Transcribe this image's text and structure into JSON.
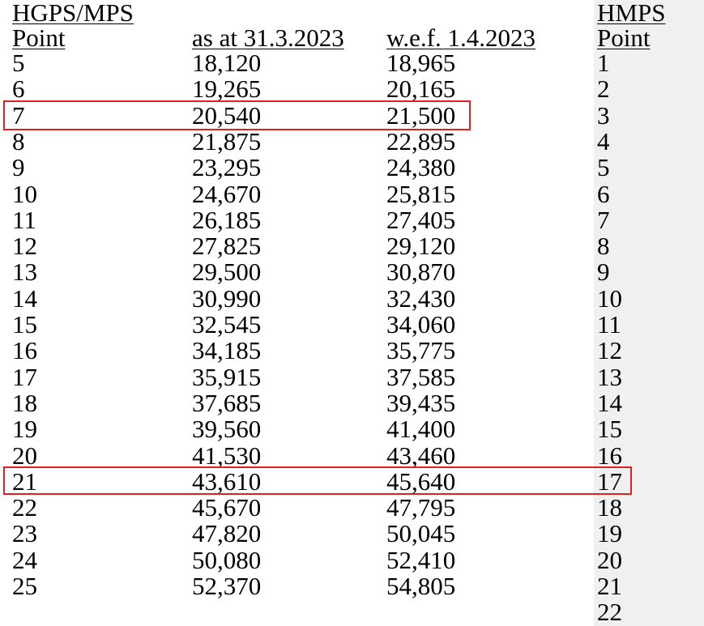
{
  "headers": {
    "hgps_mps": "HGPS/MPS",
    "point": "Point",
    "as_at": "as at 31.3.2023",
    "wef": "w.e.f. 1.4.2023",
    "hmps": "HMPS",
    "hmps_point": "Point"
  },
  "rows": [
    {
      "point": "5",
      "old": "18,120",
      "new": "18,965"
    },
    {
      "point": "6",
      "old": "19,265",
      "new": "20,165"
    },
    {
      "point": "7",
      "old": "20,540",
      "new": "21,500"
    },
    {
      "point": "8",
      "old": "21,875",
      "new": "22,895"
    },
    {
      "point": "9",
      "old": "23,295",
      "new": "24,380"
    },
    {
      "point": "10",
      "old": "24,670",
      "new": "25,815"
    },
    {
      "point": "11",
      "old": "26,185",
      "new": "27,405"
    },
    {
      "point": "12",
      "old": "27,825",
      "new": "29,120"
    },
    {
      "point": "13",
      "old": "29,500",
      "new": "30,870"
    },
    {
      "point": "14",
      "old": "30,990",
      "new": "32,430"
    },
    {
      "point": "15",
      "old": "32,545",
      "new": "34,060"
    },
    {
      "point": "16",
      "old": "34,185",
      "new": "35,775"
    },
    {
      "point": "17",
      "old": "35,915",
      "new": "37,585"
    },
    {
      "point": "18",
      "old": "37,685",
      "new": "39,435"
    },
    {
      "point": "19",
      "old": "39,560",
      "new": "41,400"
    },
    {
      "point": "20",
      "old": "41,530",
      "new": "43,460"
    },
    {
      "point": "21",
      "old": "43,610",
      "new": "45,640"
    },
    {
      "point": "22",
      "old": "45,670",
      "new": "47,795"
    },
    {
      "point": "23",
      "old": "47,820",
      "new": "50,045"
    },
    {
      "point": "24",
      "old": "50,080",
      "new": "52,410"
    },
    {
      "point": "25",
      "old": "52,370",
      "new": "54,805"
    }
  ],
  "hmps_points": [
    "1",
    "2",
    "3",
    "4",
    "5",
    "6",
    "7",
    "8",
    "9",
    "10",
    "11",
    "12",
    "13",
    "14",
    "15",
    "16",
    "17",
    "18",
    "19",
    "20",
    "21",
    "22"
  ],
  "highlight_color": "#e02020",
  "side_column_color": "#f0f0f0"
}
